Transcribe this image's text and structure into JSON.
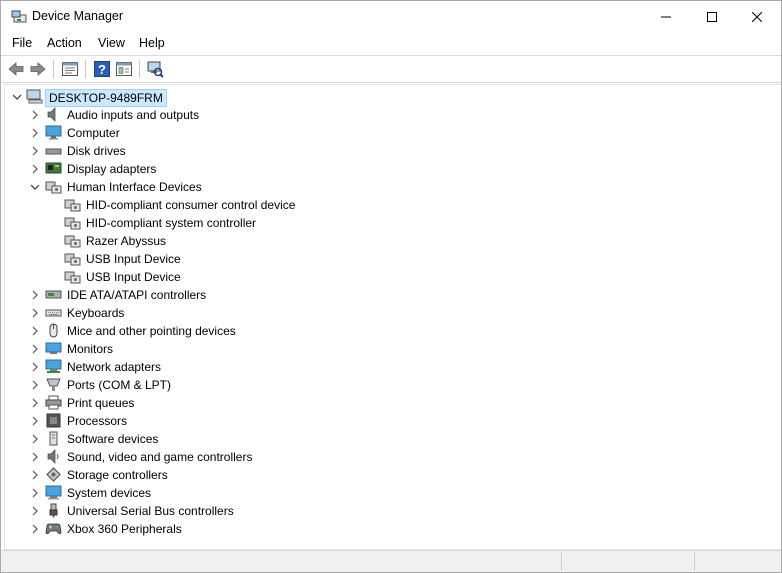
{
  "window": {
    "title": "Device Manager"
  },
  "menu": {
    "file": "File",
    "action": "Action",
    "view": "View",
    "help": "Help"
  },
  "toolbar": {
    "buttons": [
      "back-icon",
      "forward-icon",
      "properties-sheet-icon",
      "help-icon",
      "details-icon",
      "scan-hardware-icon"
    ]
  },
  "tree": {
    "root": "DESKTOP-9489FRM",
    "categories": [
      {
        "label": "Audio inputs and outputs",
        "icon": "speaker-icon",
        "expanded": false
      },
      {
        "label": "Computer",
        "icon": "computer-icon",
        "expanded": false
      },
      {
        "label": "Disk drives",
        "icon": "disk-drive-icon",
        "expanded": false
      },
      {
        "label": "Display adapters",
        "icon": "display-adapter-icon",
        "expanded": false
      },
      {
        "label": "Human Interface Devices",
        "icon": "hid-icon",
        "expanded": true,
        "children": [
          "HID-compliant consumer control device",
          "HID-compliant system controller",
          "Razer Abyssus",
          "USB Input Device",
          "USB Input Device"
        ]
      },
      {
        "label": "IDE ATA/ATAPI controllers",
        "icon": "ide-controller-icon",
        "expanded": false
      },
      {
        "label": "Keyboards",
        "icon": "keyboard-icon",
        "expanded": false
      },
      {
        "label": "Mice and other pointing devices",
        "icon": "mouse-icon",
        "expanded": false
      },
      {
        "label": "Monitors",
        "icon": "monitor-icon",
        "expanded": false
      },
      {
        "label": "Network adapters",
        "icon": "network-adapter-icon",
        "expanded": false
      },
      {
        "label": "Ports (COM & LPT)",
        "icon": "port-icon",
        "expanded": false
      },
      {
        "label": "Print queues",
        "icon": "printer-icon",
        "expanded": false
      },
      {
        "label": "Processors",
        "icon": "processor-icon",
        "expanded": false
      },
      {
        "label": "Software devices",
        "icon": "software-device-icon",
        "expanded": false
      },
      {
        "label": "Sound, video and game controllers",
        "icon": "sound-icon",
        "expanded": false
      },
      {
        "label": "Storage controllers",
        "icon": "storage-controller-icon",
        "expanded": false
      },
      {
        "label": "System devices",
        "icon": "system-device-icon",
        "expanded": false
      },
      {
        "label": "Universal Serial Bus controllers",
        "icon": "usb-icon",
        "expanded": false
      },
      {
        "label": "Xbox 360 Peripherals",
        "icon": "gamepad-icon",
        "expanded": false
      }
    ]
  },
  "colors": {
    "selection": "#cce8ff",
    "selection_border": "#99d1ff",
    "statusbar": "#f0f0f0"
  }
}
